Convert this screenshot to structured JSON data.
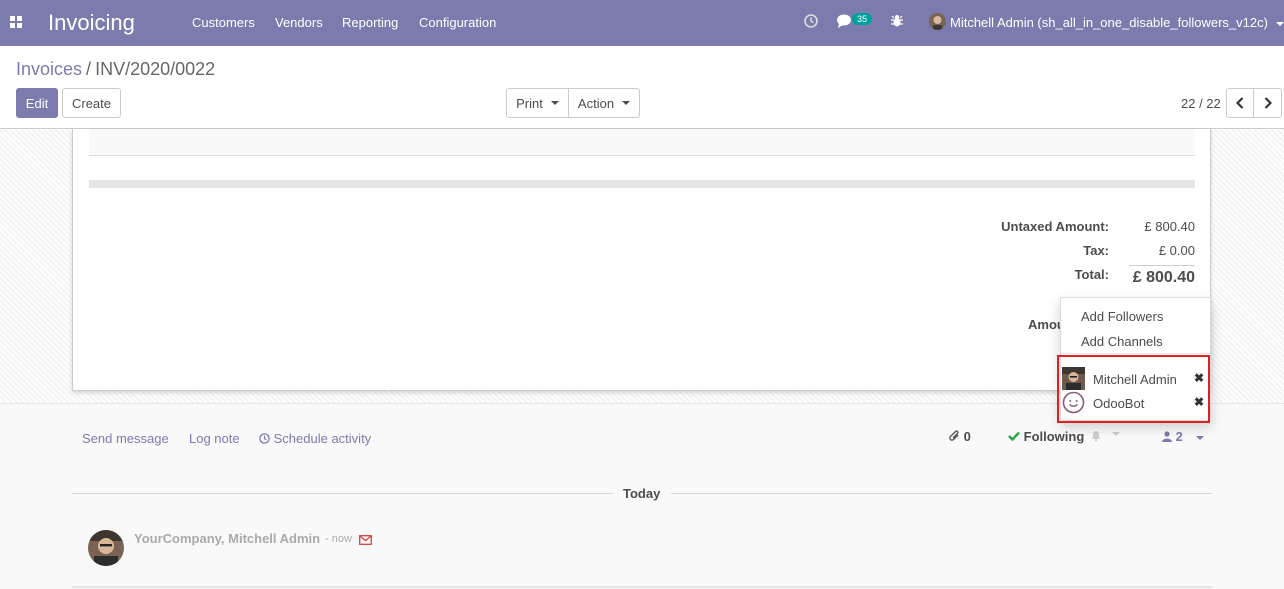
{
  "navbar": {
    "app_title": "Invoicing",
    "menu": [
      "Customers",
      "Vendors",
      "Reporting",
      "Configuration"
    ],
    "messages_count": "35",
    "user_name": "Mitchell Admin (sh_all_in_one_disable_followers_v12c)"
  },
  "control_panel": {
    "breadcrumb_parent": "Invoices",
    "breadcrumb_separator": "/",
    "breadcrumb_current": "INV/2020/0022",
    "edit_label": "Edit",
    "create_label": "Create",
    "print_label": "Print",
    "action_label": "Action",
    "pager_value": "22 / 22"
  },
  "totals": {
    "untaxed_label": "Untaxed Amount:",
    "untaxed_value": "£ 800.40",
    "tax_label": "Tax:",
    "tax_value": "£ 0.00",
    "total_label": "Total:",
    "total_value": "£ 800.40",
    "amount_due_partial": "Amou"
  },
  "followers_dropdown": {
    "add_followers": "Add Followers",
    "add_channels": "Add Channels",
    "followers": [
      {
        "name": "Mitchell Admin"
      },
      {
        "name": "OdooBot"
      }
    ]
  },
  "chatter": {
    "send_message": "Send message",
    "log_note": "Log note",
    "schedule_activity": "Schedule activity",
    "attachments_count": "0",
    "following_label": "Following",
    "followers_count": "2",
    "today_label": "Today",
    "message_author": "YourCompany, Mitchell Admin",
    "message_time": "- now"
  },
  "colors": {
    "brand": "#7c7bad",
    "teal_badge": "#00a09d",
    "highlight_border": "#e02020",
    "following_check": "#28a745"
  }
}
